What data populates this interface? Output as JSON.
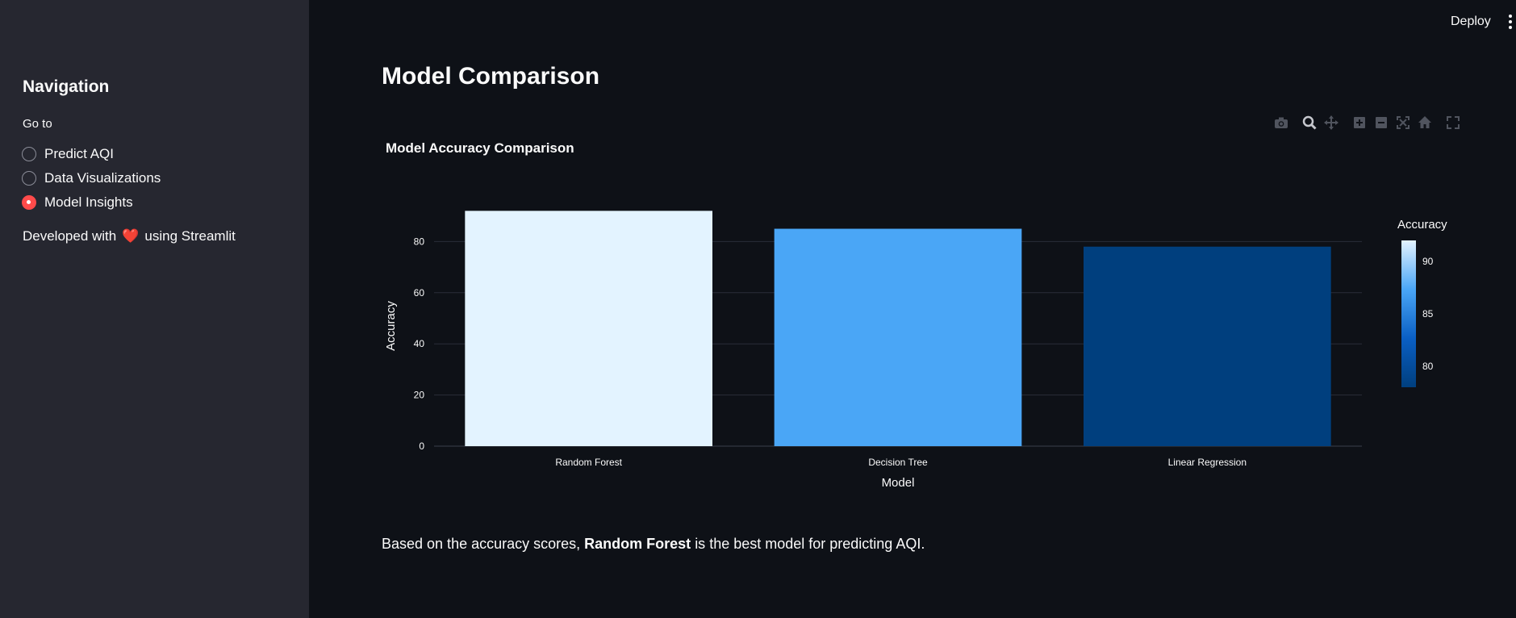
{
  "sidebar": {
    "title": "Navigation",
    "goto_label": "Go to",
    "options": [
      {
        "label": "Predict AQI",
        "selected": false
      },
      {
        "label": "Data Visualizations",
        "selected": false
      },
      {
        "label": "Model Insights",
        "selected": true
      }
    ],
    "footer_prefix": "Developed with",
    "footer_heart": "❤️",
    "footer_suffix": "using Streamlit"
  },
  "header": {
    "deploy_label": "Deploy"
  },
  "main": {
    "title": "Model Comparison",
    "summary_prefix": "Based on the accuracy scores,",
    "summary_bold": "Random Forest",
    "summary_suffix": "is the best model for predicting AQI."
  },
  "modebar_icons": [
    "camera-icon",
    "zoom-icon",
    "pan-icon",
    "zoom-in-icon",
    "zoom-out-icon",
    "autoscale-icon",
    "reset-axes-icon",
    "fullscreen-icon"
  ],
  "colors": {
    "accent": "#ff4b4b",
    "sidebar_bg": "#262730",
    "main_bg": "#0e1117"
  },
  "chart_data": {
    "type": "bar",
    "title": "Model Accuracy Comparison",
    "xlabel": "Model",
    "ylabel": "Accuracy",
    "categories": [
      "Random Forest",
      "Decision Tree",
      "Linear Regression"
    ],
    "values": [
      92,
      85,
      78
    ],
    "bar_colors": [
      "#e3f3ff",
      "#4aa6f6",
      "#003f7e"
    ],
    "ylim": [
      0,
      94
    ],
    "yticks": [
      0,
      20,
      40,
      60,
      80
    ],
    "grid": true,
    "colorbar": {
      "title": "Accuracy",
      "ticks": [
        80,
        85,
        90
      ],
      "range": [
        78,
        92
      ],
      "colors": [
        "#003f7e",
        "#0a5fc4",
        "#4aa6f6",
        "#e3f3ff"
      ]
    }
  }
}
